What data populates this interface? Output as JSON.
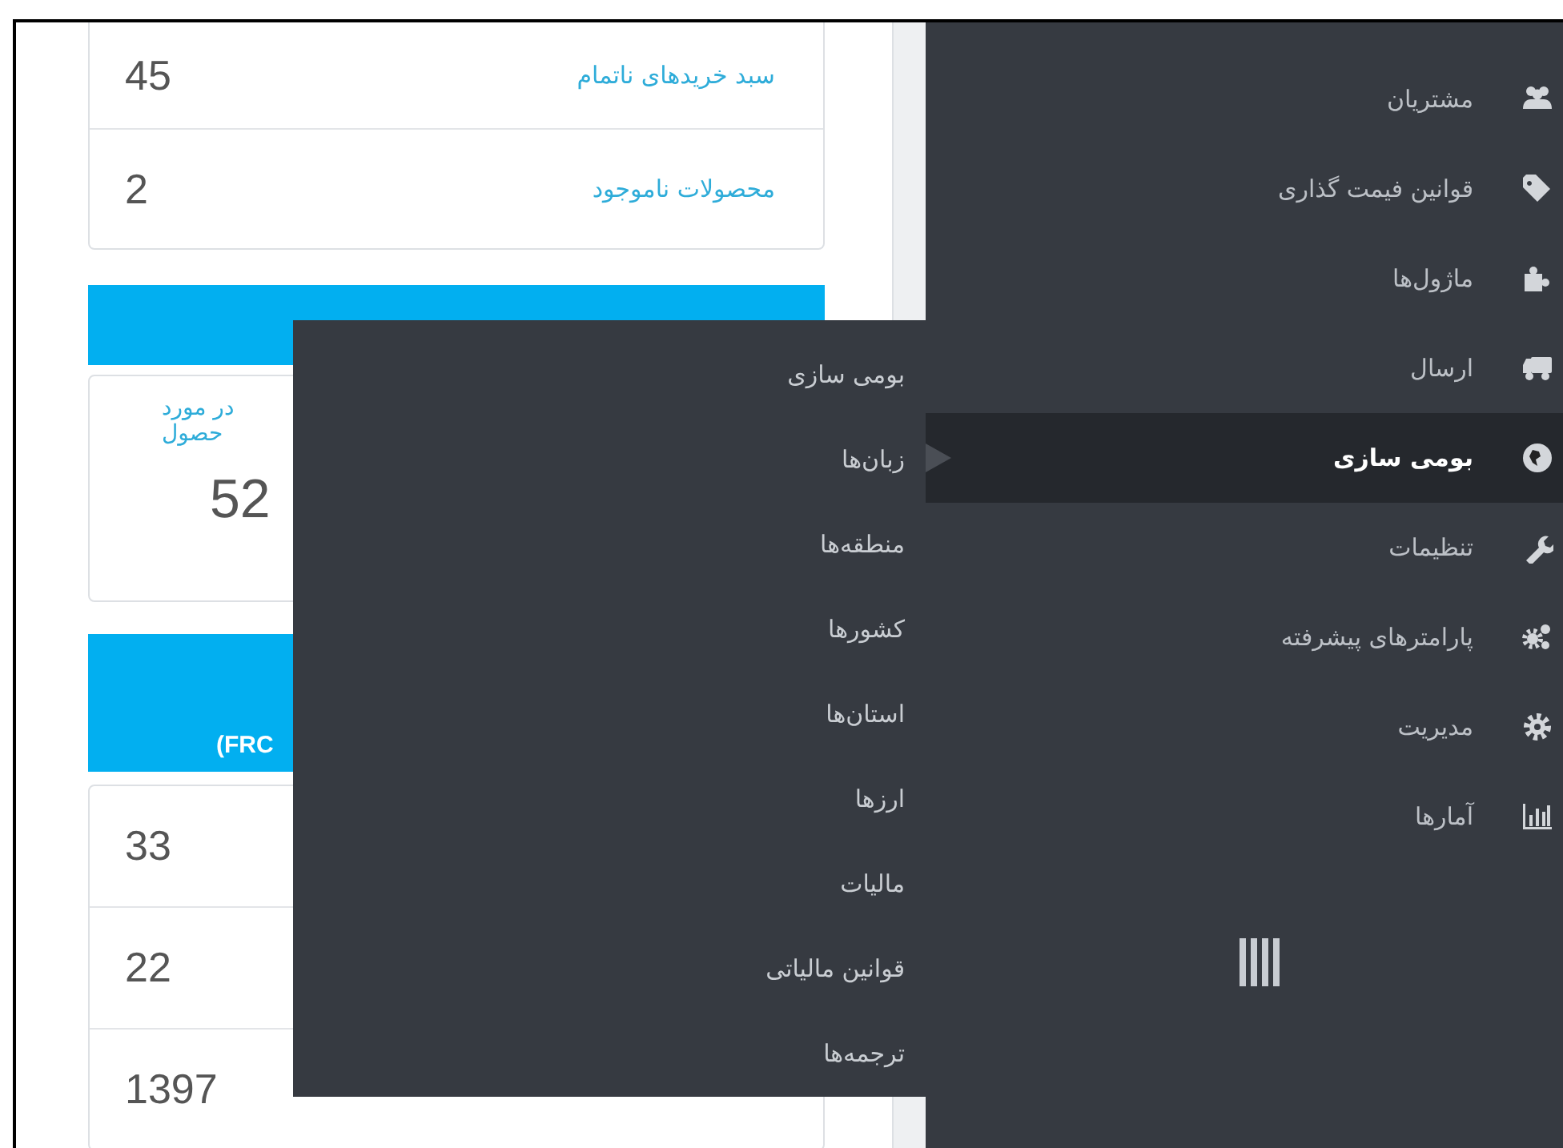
{
  "stats_top": [
    {
      "label": "سبد خریدهای ناتمام",
      "value": "45"
    },
    {
      "label": "محصولات ناموجود",
      "value": "2"
    }
  ],
  "notice_panel": {
    "text_lines": [
      "در مورد",
      "حصول"
    ],
    "value": "52"
  },
  "second_panel": {
    "header": "(FRC",
    "values": [
      "33",
      "22",
      "1397"
    ]
  },
  "sidebar": {
    "items": [
      {
        "label": "مشتریان",
        "selected": false
      },
      {
        "label": "قوانین فیمت گذاری",
        "selected": false
      },
      {
        "label": "ماژول‌ها",
        "selected": false
      },
      {
        "label": "ارسال",
        "selected": false
      },
      {
        "label": "بومی سازی",
        "selected": true
      },
      {
        "label": "تنظیمات",
        "selected": false
      },
      {
        "label": "پارامترهای پیشرفته",
        "selected": false
      },
      {
        "label": "مدیریت",
        "selected": false
      },
      {
        "label": "آمارها",
        "selected": false
      }
    ]
  },
  "submenu": {
    "items": [
      {
        "label": "بومی سازی"
      },
      {
        "label": "زبان‌ها"
      },
      {
        "label": "منطقه‌ها"
      },
      {
        "label": "کشورها"
      },
      {
        "label": "استان‌ها"
      },
      {
        "label": "ارزها"
      },
      {
        "label": "مالیات"
      },
      {
        "label": "قوانین مالیاتی"
      },
      {
        "label": "ترجمه‌ها"
      }
    ]
  }
}
